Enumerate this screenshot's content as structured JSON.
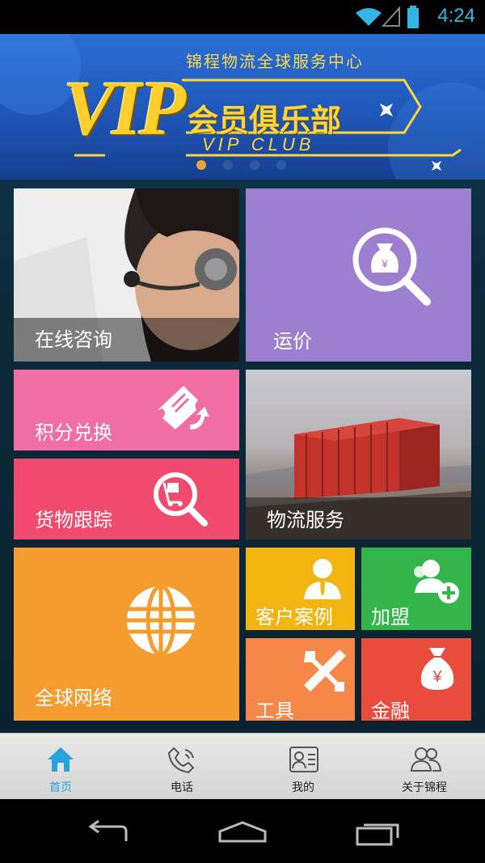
{
  "status_bar": {
    "time": "4:24"
  },
  "banner": {
    "subtitle": "锦程物流全球服务中心",
    "logo_text": "VIP",
    "club_text": "会员俱乐部",
    "club_en": "VIP CLUB",
    "carousel_page": 1,
    "carousel_total": 4
  },
  "tiles": {
    "consult": {
      "label": "在线咨询"
    },
    "freight": {
      "label": "运价"
    },
    "points": {
      "label": "积分兑换"
    },
    "tracking": {
      "label": "货物跟踪"
    },
    "logistics": {
      "label": "物流服务"
    },
    "global": {
      "label": "全球网络"
    },
    "cases": {
      "label": "客户案例"
    },
    "join": {
      "label": "加盟"
    },
    "tools": {
      "label": "工具"
    },
    "finance": {
      "label": "金融"
    }
  },
  "bottom_nav": {
    "items": [
      {
        "label": "首页",
        "icon": "home-icon",
        "active": true
      },
      {
        "label": "电话",
        "icon": "phone-icon"
      },
      {
        "label": "我的",
        "icon": "profile-card-icon"
      },
      {
        "label": "关于锦程",
        "icon": "people-icon"
      }
    ]
  },
  "colors": {
    "accent": "#33b5e5",
    "purple": "#9c80cf",
    "pink": "#f06ea4",
    "red_pink": "#f04a6e",
    "orange": "#f59c2e",
    "yellow": "#f2b411",
    "green": "#33b54a",
    "light_orange": "#f58849",
    "red": "#e94b3d"
  }
}
